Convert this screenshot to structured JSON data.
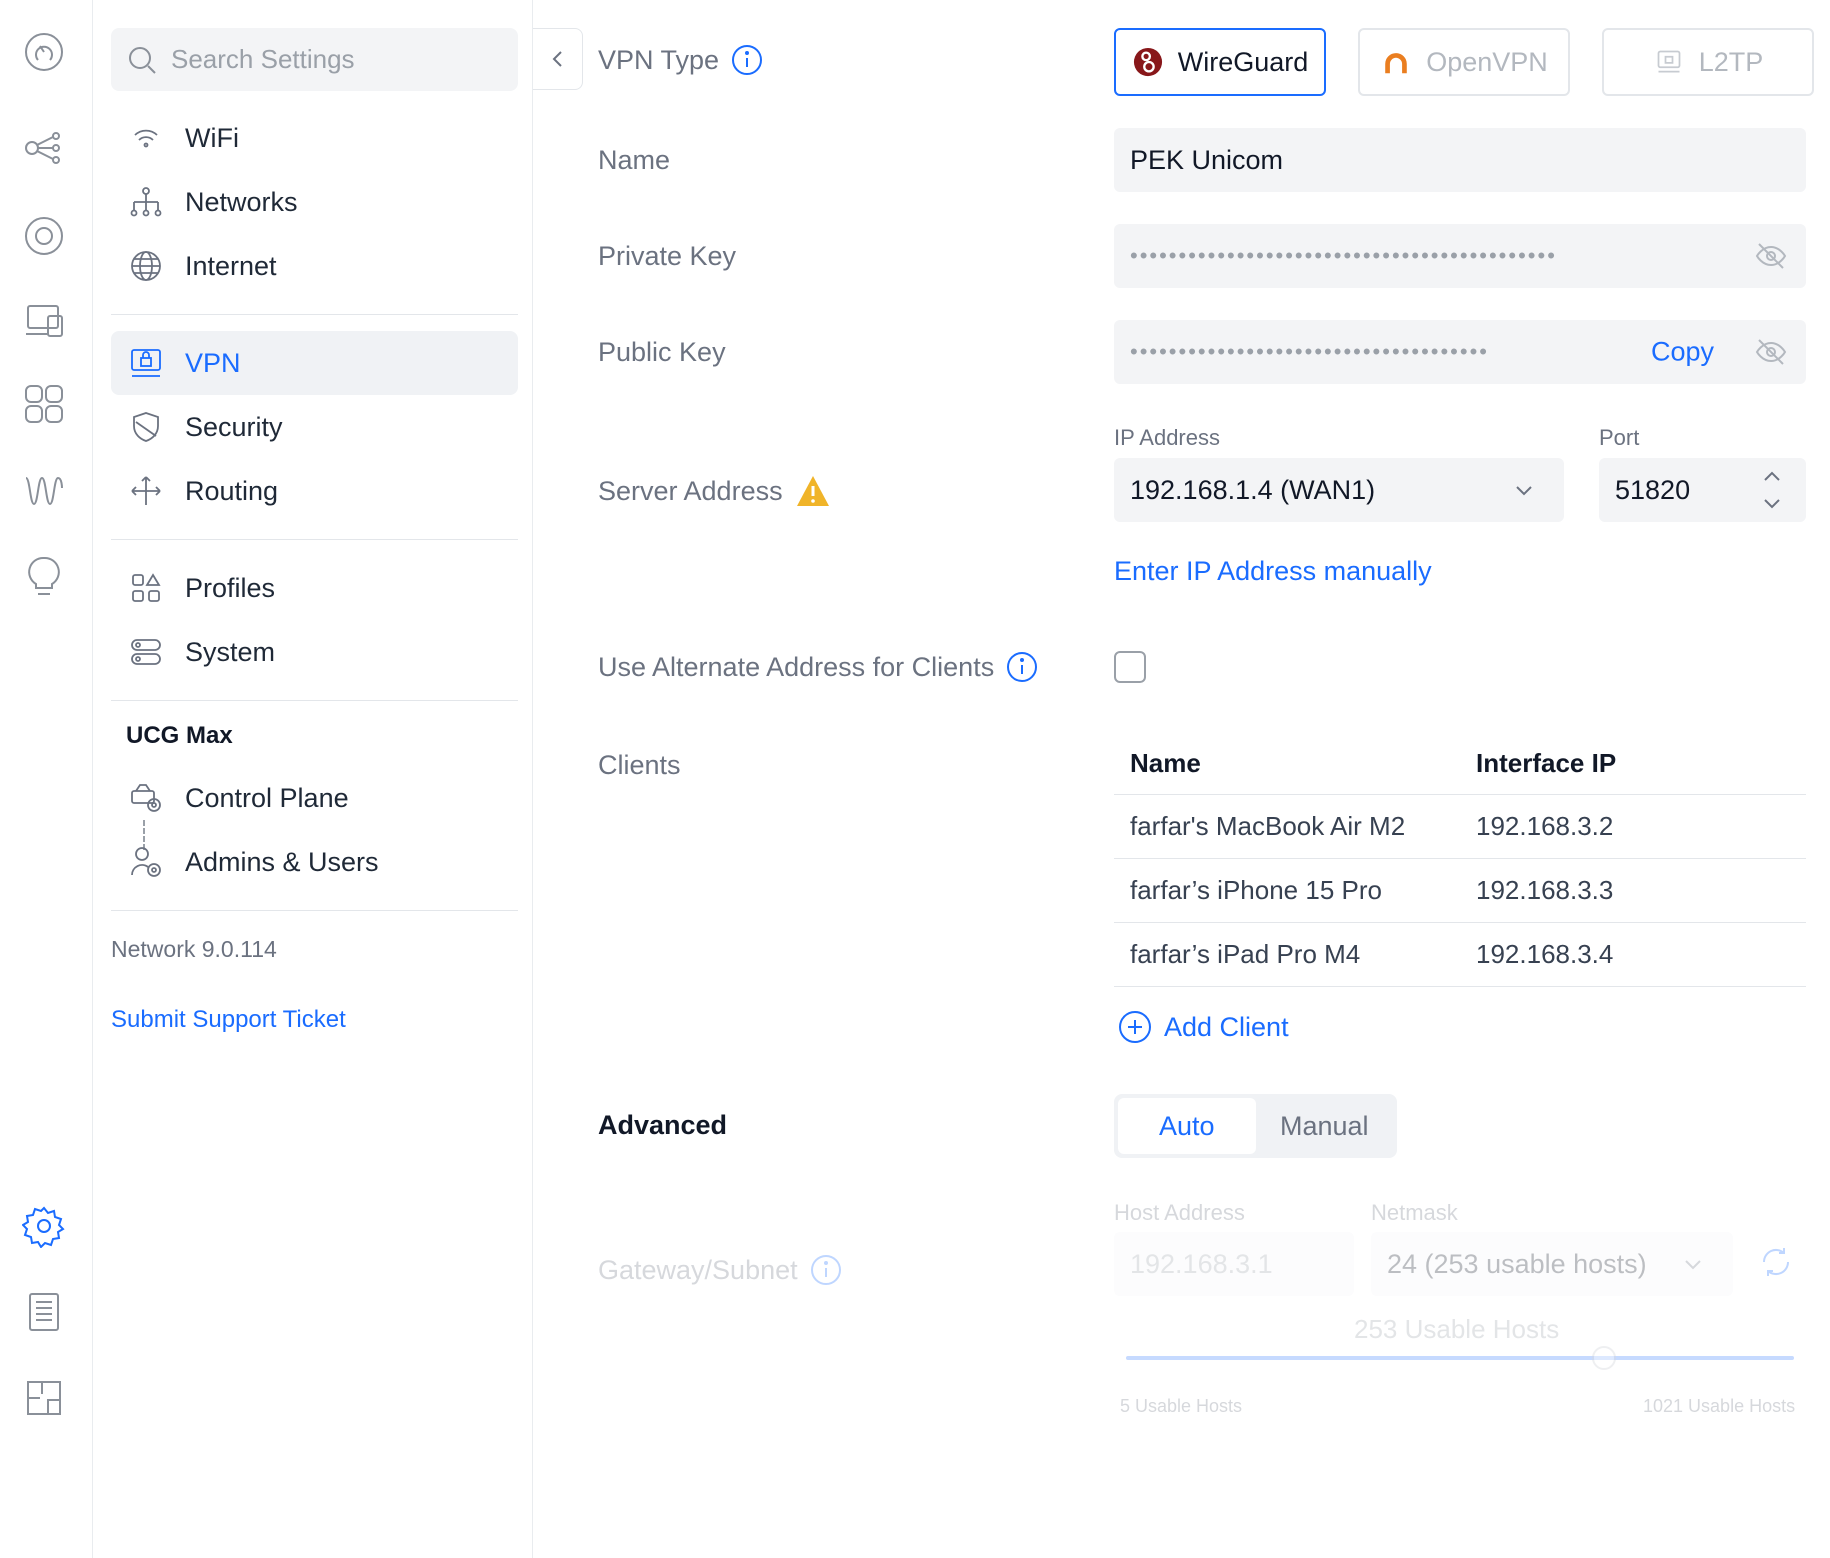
{
  "rail": {
    "icons": [
      "dashboard-icon",
      "topology-icon",
      "unifi-devices-icon",
      "client-devices-icon",
      "apps-icon",
      "insights-icon",
      "alerts-icon",
      "settings-icon",
      "logs-icon",
      "floorplan-icon"
    ]
  },
  "sidebar": {
    "search_placeholder": "Search Settings",
    "groups": [
      [
        {
          "label": "WiFi"
        },
        {
          "label": "Networks"
        },
        {
          "label": "Internet"
        }
      ],
      [
        {
          "label": "VPN"
        },
        {
          "label": "Security"
        },
        {
          "label": "Routing"
        }
      ],
      [
        {
          "label": "Profiles"
        },
        {
          "label": "System"
        }
      ]
    ],
    "ucg_title": "UCG Max",
    "ucg_items": [
      {
        "label": "Control Plane"
      },
      {
        "label": "Admins & Users"
      }
    ],
    "version": "Network 9.0.114",
    "support_link": "Submit Support Ticket"
  },
  "form": {
    "vpn_type_label": "VPN Type",
    "vpn_types": [
      {
        "label": "WireGuard",
        "state": "selected"
      },
      {
        "label": "OpenVPN",
        "state": "disabled"
      },
      {
        "label": "L2TP",
        "state": "disabled"
      }
    ],
    "name_label": "Name",
    "name_value": "PEK Unicom",
    "private_key_label": "Private Key",
    "private_key_mask": "••••••••••••••••••••••••••••••••••••••••••••",
    "public_key_label": "Public Key",
    "public_key_mask": "•••••••••••••••••••••••••••••••••••••",
    "copy_label": "Copy",
    "server_address_label": "Server Address",
    "ip_address_label": "IP Address",
    "ip_address_value": "192.168.1.4 (WAN1)",
    "port_label": "Port",
    "port_value": "51820",
    "enter_ip_manual": "Enter IP Address manually",
    "alt_address_label": "Use Alternate Address for Clients",
    "alt_address_checked": false,
    "clients_label": "Clients",
    "clients_columns": [
      "Name",
      "Interface IP"
    ],
    "clients": [
      {
        "name": "farfar's MacBook Air M2",
        "ip": "192.168.3.2"
      },
      {
        "name": "farfar’s iPhone 15 Pro",
        "ip": "192.168.3.3"
      },
      {
        "name": "farfar’s iPad Pro M4",
        "ip": "192.168.3.4"
      }
    ],
    "add_client": "Add Client",
    "advanced_label": "Advanced",
    "advanced_options": [
      "Auto",
      "Manual"
    ],
    "advanced_selected": "Auto",
    "gateway_label": "Gateway/Subnet",
    "host_address_label": "Host Address",
    "host_address_value": "192.168.3.1",
    "netmask_label": "Netmask",
    "netmask_value": "24 (253 usable hosts)",
    "usable_hosts_title": "253 Usable Hosts",
    "usable_hosts_min": "5 Usable Hosts",
    "usable_hosts_max": "1021 Usable Hosts"
  },
  "colors": {
    "accent": "#1a6cff",
    "warning": "#f0b429",
    "wireguard": "#88171a",
    "openvpn": "#ea7e20"
  }
}
